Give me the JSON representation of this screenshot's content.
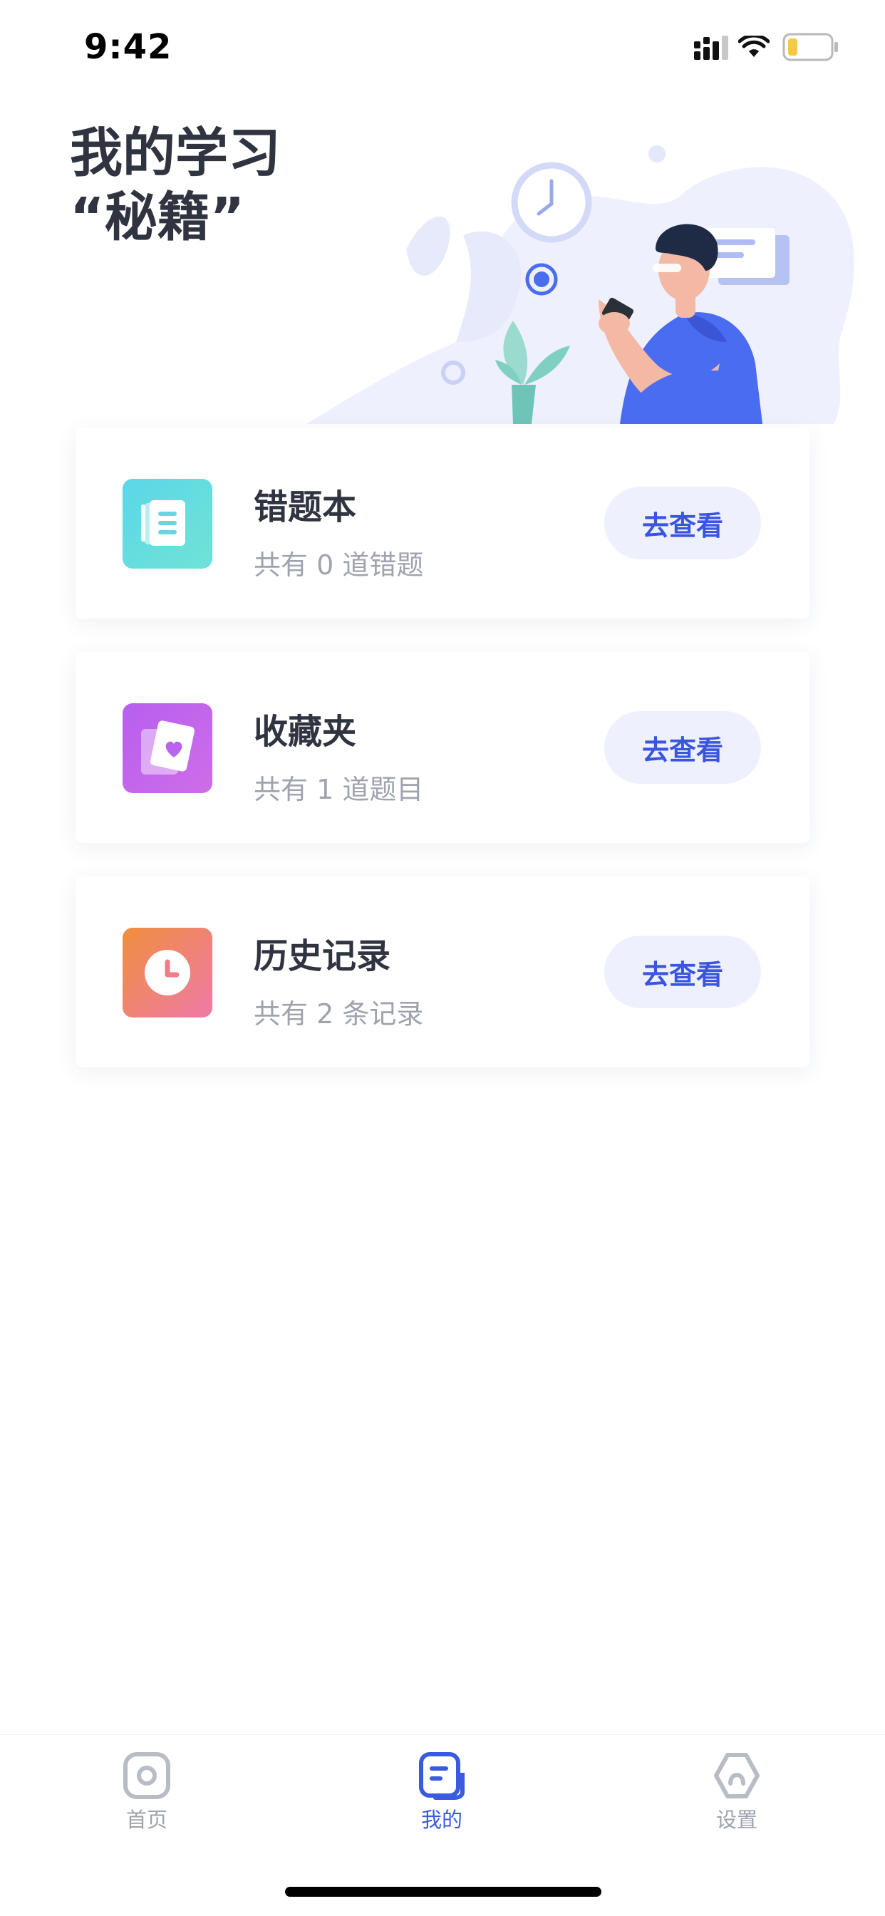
{
  "status_bar": {
    "time": "9:42"
  },
  "header": {
    "title_line1": "我的学习",
    "title_line2": "“秘籍”"
  },
  "cards": [
    {
      "title": "错题本",
      "subtitle": "共有 0 道错题",
      "button": "去查看",
      "icon": "notebook-icon"
    },
    {
      "title": "收藏夹",
      "subtitle": "共有 1 道题目",
      "button": "去查看",
      "icon": "heart-card-icon"
    },
    {
      "title": "历史记录",
      "subtitle": "共有 2 条记录",
      "button": "去查看",
      "icon": "clock-icon"
    }
  ],
  "tab_bar": {
    "tabs": [
      {
        "label": "首页",
        "icon": "home-icon",
        "active": false
      },
      {
        "label": "我的",
        "icon": "mine-icon",
        "active": true
      },
      {
        "label": "设置",
        "icon": "settings-icon",
        "active": false
      }
    ]
  },
  "colors": {
    "accent": "#3a55e0",
    "button_bg": "#eef0fd",
    "title_text": "#2f3440",
    "sub_text": "#9ea3ad"
  }
}
